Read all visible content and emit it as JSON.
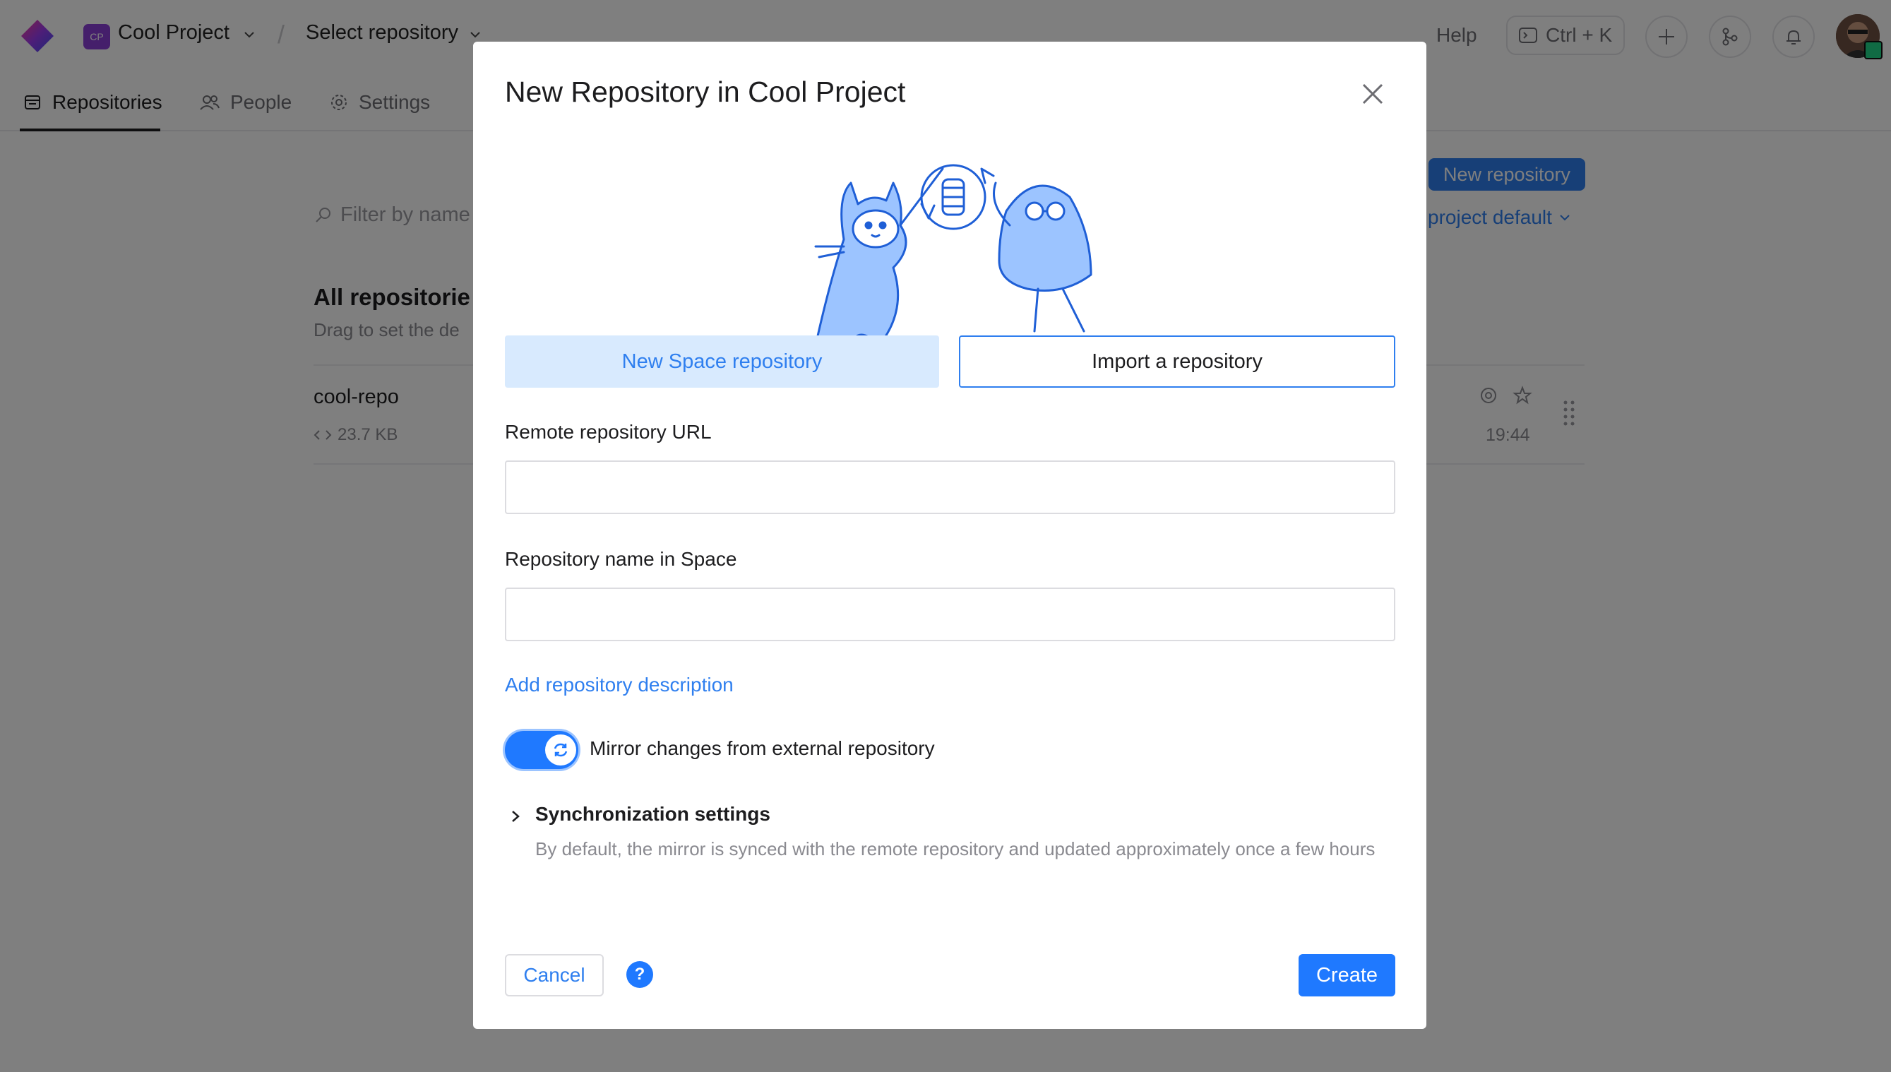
{
  "header": {
    "project_badge": "CP",
    "project_name": "Cool Project",
    "repo_selector": "Select repository",
    "help": "Help",
    "shortcut": "Ctrl + K"
  },
  "tabs": [
    {
      "label": "Repositories",
      "icon": "repository-icon"
    },
    {
      "label": "People",
      "icon": "people-icon"
    },
    {
      "label": "Settings",
      "icon": "gear-icon"
    }
  ],
  "background": {
    "filter_placeholder": "Filter by name",
    "new_repo_button": "New repository",
    "default_label": "project default",
    "section_title": "All repositorie",
    "section_hint": "Drag to set the de",
    "repo": {
      "name": "cool-repo",
      "size": "23.7 KB",
      "time": "19:44"
    }
  },
  "modal": {
    "title": "New Repository in Cool Project",
    "segments": [
      "New Space repository",
      "Import a repository"
    ],
    "remote_url_label": "Remote repository URL",
    "remote_url_value": "",
    "name_label": "Repository name in Space",
    "name_value": "",
    "add_description": "Add repository description",
    "mirror_label": "Mirror changes from external repository",
    "mirror_enabled": true,
    "sync_title": "Synchronization settings",
    "sync_desc": "By default, the mirror is synced with the remote repository and updated approximately once a few hours",
    "cancel": "Cancel",
    "help": "?",
    "create": "Create"
  },
  "colors": {
    "accent": "#1f79ff",
    "accent_light": "#d8eafe",
    "project_badge": "#8a3ed6"
  }
}
